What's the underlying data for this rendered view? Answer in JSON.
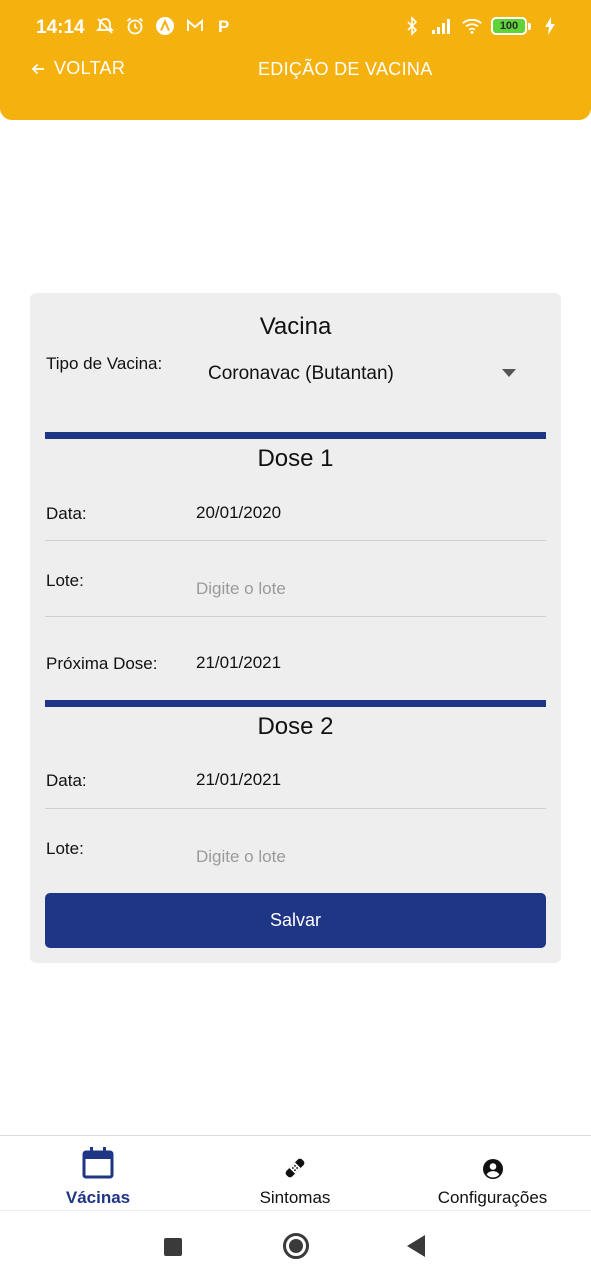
{
  "status_bar": {
    "time": "14:14",
    "battery_level": "100",
    "left_icons": [
      "notification-off-icon",
      "alarm-icon",
      "app-a-icon",
      "gmail-icon",
      "app-p-icon"
    ],
    "right_icons": [
      "bluetooth-icon",
      "signal-icon",
      "wifi-icon",
      "battery-icon",
      "charging-icon"
    ]
  },
  "header": {
    "back_label": "VOLTAR",
    "title": "EDIÇÃO DE VACINA",
    "color": "#f5b10e"
  },
  "form": {
    "vaccine_section_title": "Vacina",
    "vaccine_type_label": "Tipo de Vacina:",
    "vaccine_type_value": "Coronavac (Butantan)",
    "dose1": {
      "title": "Dose 1",
      "date_label": "Data:",
      "date_value": "20/01/2020",
      "lot_label": "Lote:",
      "lot_placeholder": "Digite o lote",
      "next_dose_label": "Próxima Dose:",
      "next_dose_value": "21/01/2021"
    },
    "dose2": {
      "title": "Dose 2",
      "date_label": "Data:",
      "date_value": "21/01/2021",
      "lot_label": "Lote:",
      "lot_placeholder": "Digite o lote"
    },
    "save_label": "Salvar",
    "accent_color": "#1f3585"
  },
  "tabs": [
    {
      "label": "Vácinas",
      "icon": "calendar-icon",
      "active": true
    },
    {
      "label": "Sintomas",
      "icon": "bandage-icon",
      "active": false
    },
    {
      "label": "Configurações",
      "icon": "account-circle-icon",
      "active": false
    }
  ],
  "system_nav": [
    "recents-button",
    "home-button",
    "back-button"
  ]
}
